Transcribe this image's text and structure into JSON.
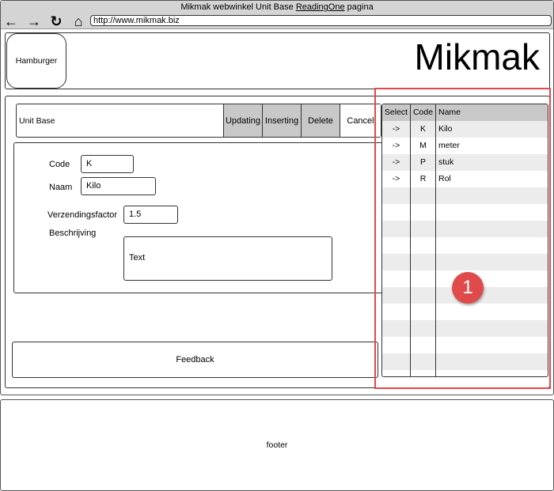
{
  "window": {
    "title_prefix": "Mikmak webwinkel Unit Base ",
    "title_link": "ReadingOne",
    "title_suffix": " pagina"
  },
  "toolbar": {
    "back_icon": "←",
    "forward_icon": "→",
    "reload_icon": "↻",
    "home_icon": "⌂",
    "url": "http://www.mikmak.biz"
  },
  "header": {
    "hamburger_label": "Hamburger",
    "logo_text": "Mikmak"
  },
  "unit_bar": {
    "title": "Unit Base",
    "buttons": [
      "Updating",
      "Inserting",
      "Delete",
      "Cancel"
    ]
  },
  "form": {
    "code_label": "Code",
    "code_value": "K",
    "naam_label": "Naam",
    "naam_value": "Kilo",
    "factor_label": "Verzendingsfactor",
    "factor_value": "1.5",
    "beschrijving_label": "Beschrijving",
    "beschrijving_value": "Text"
  },
  "feedback": {
    "label": "Feedback"
  },
  "table": {
    "headers": [
      "Select",
      "Code",
      "Name"
    ],
    "rows": [
      {
        "select": "->",
        "code": "K",
        "name": "Kilo"
      },
      {
        "select": "->",
        "code": "M",
        "name": "meter"
      },
      {
        "select": "->",
        "code": "P",
        "name": "stuk"
      },
      {
        "select": "->",
        "code": "R",
        "name": "Rol"
      }
    ]
  },
  "annotation": {
    "badge": "1",
    "color": "#e04a4a"
  },
  "footer": {
    "label": "footer"
  }
}
